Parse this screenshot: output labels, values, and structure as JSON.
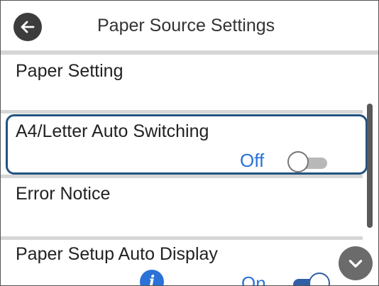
{
  "header": {
    "title": "Paper Source Settings",
    "back_icon": "arrow-left-icon"
  },
  "menu": {
    "items": [
      {
        "label": "Paper Setting"
      },
      {
        "label": "A4/Letter Auto Switching",
        "value": "Off",
        "toggle": "off",
        "selected": true
      },
      {
        "label": "Error Notice"
      },
      {
        "label": "Paper Setup Auto Display",
        "value": "On",
        "toggle": "on",
        "info_icon": "info-icon"
      }
    ]
  },
  "controls": {
    "scroll_down_icon": "chevron-down-icon"
  },
  "colors": {
    "accent_blue": "#2a72d8",
    "selection_border": "#23537f",
    "divider": "#d6d6d6"
  }
}
